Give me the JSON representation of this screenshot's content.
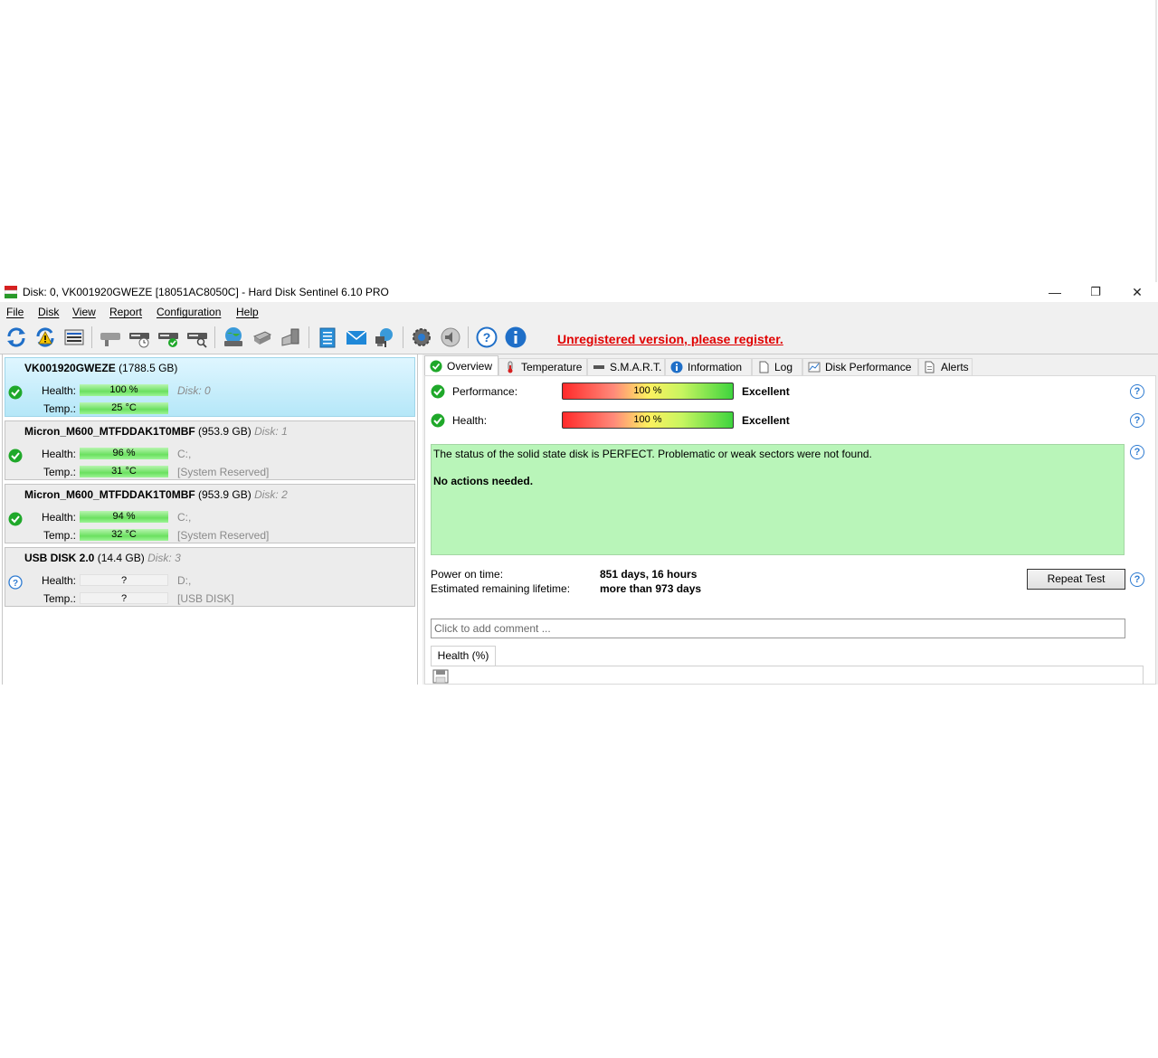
{
  "window": {
    "title": "Disk: 0, VK001920GWEZE [18051AC8050C]  -  Hard Disk Sentinel 6.10 PRO",
    "minimize": "—",
    "restore": "❐",
    "close": "✕"
  },
  "menu": [
    "File",
    "Disk",
    "View",
    "Report",
    "Configuration",
    "Help"
  ],
  "toolbar": {
    "icons": [
      "refresh-icon",
      "refresh-warning-icon",
      "disk-info-icon",
      "disk-gray-icon",
      "disk-clock-icon",
      "disk-check-icon",
      "disk-search-icon",
      "globe-disk-icon",
      "usb-disk-icon",
      "external-disk-icon",
      "notes-icon",
      "email-icon",
      "network-icon",
      "settings-icon",
      "sound-icon",
      "help-icon",
      "info-icon"
    ],
    "register_text": "Unregistered version, please register."
  },
  "disks": [
    {
      "name": "VK001920GWEZE",
      "size": "(1788.5 GB)",
      "num": "Disk: 0",
      "health_label": "Health:",
      "temp_label": "Temp.:",
      "health": "100 %",
      "temp": "25 °C",
      "extra1": "Disk: 0",
      "extra2": "",
      "status": "ok"
    },
    {
      "name": "Micron_M600_MTFDDAK1T0MBF",
      "size": "(953.9 GB)",
      "num": "Disk: 1",
      "health_label": "Health:",
      "temp_label": "Temp.:",
      "health": "96 %",
      "temp": "31 °C",
      "extra1": "C:,",
      "extra2": "[System Reserved]",
      "status": "ok"
    },
    {
      "name": "Micron_M600_MTFDDAK1T0MBF",
      "size": "(953.9 GB)",
      "num": "Disk: 2",
      "health_label": "Health:",
      "temp_label": "Temp.:",
      "health": "94 %",
      "temp": "32 °C",
      "extra1": "C:,",
      "extra2": "[System Reserved]",
      "status": "ok"
    },
    {
      "name": "USB DISK 2.0",
      "size": "(14.4 GB)",
      "num": "Disk: 3",
      "health_label": "Health:",
      "temp_label": "Temp.:",
      "health": "?",
      "temp": "?",
      "extra1": "D:,",
      "extra2": "[USB DISK]",
      "status": "unknown"
    }
  ],
  "tabs": [
    "Overview",
    "Temperature",
    "S.M.A.R.T.",
    "Information",
    "Log",
    "Disk Performance",
    "Alerts"
  ],
  "overview": {
    "performance_label": "Performance:",
    "performance_value": "100 %",
    "performance_word": "Excellent",
    "health_label": "Health:",
    "health_value": "100 %",
    "health_word": "Excellent",
    "status_text": "The status of the solid state disk is PERFECT. Problematic or weak sectors were not found.",
    "status_action": "No actions needed.",
    "power_on_label": "Power on time:",
    "power_on_value": "851 days, 16 hours",
    "lifetime_label": "Estimated remaining lifetime:",
    "lifetime_value": "more than 973 days",
    "repeat_button": "Repeat Test",
    "comment_placeholder": "Click to add comment ...",
    "subtab": "Health (%)",
    "help_glyph": "?"
  },
  "colors": {
    "register": "#e00000",
    "ok_green": "#1fa82a",
    "status_bg": "#b9f5b9",
    "selected_disk": "#b5e7f8",
    "help_blue": "#2e7bd1"
  }
}
